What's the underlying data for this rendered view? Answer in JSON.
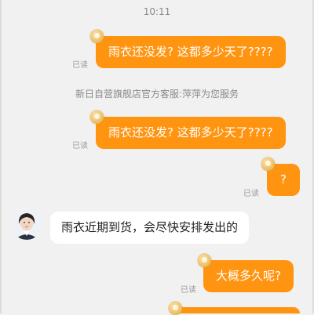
{
  "chat": {
    "timestamp": "10:11",
    "system_notice": "新日自营旗舰店官方客服:萍萍为您服务",
    "messages": [
      {
        "sender": "user",
        "text": "雨衣还没发? 这都多少天了????",
        "status": "已读"
      },
      {
        "sender": "user",
        "text": "雨衣还没发? 这都多少天了????",
        "status": "已读"
      },
      {
        "sender": "user",
        "text": "?",
        "status": "已读"
      },
      {
        "sender": "agent",
        "text": "雨衣近期到货，会尽快安排发出的"
      },
      {
        "sender": "user",
        "text": "大概多久呢?",
        "status": "已读"
      }
    ]
  },
  "colors": {
    "background": "#f1f1f1",
    "user_bubble": "#ff9411",
    "agent_bubble": "#ffffff",
    "muted_text": "#8a8a8a"
  }
}
